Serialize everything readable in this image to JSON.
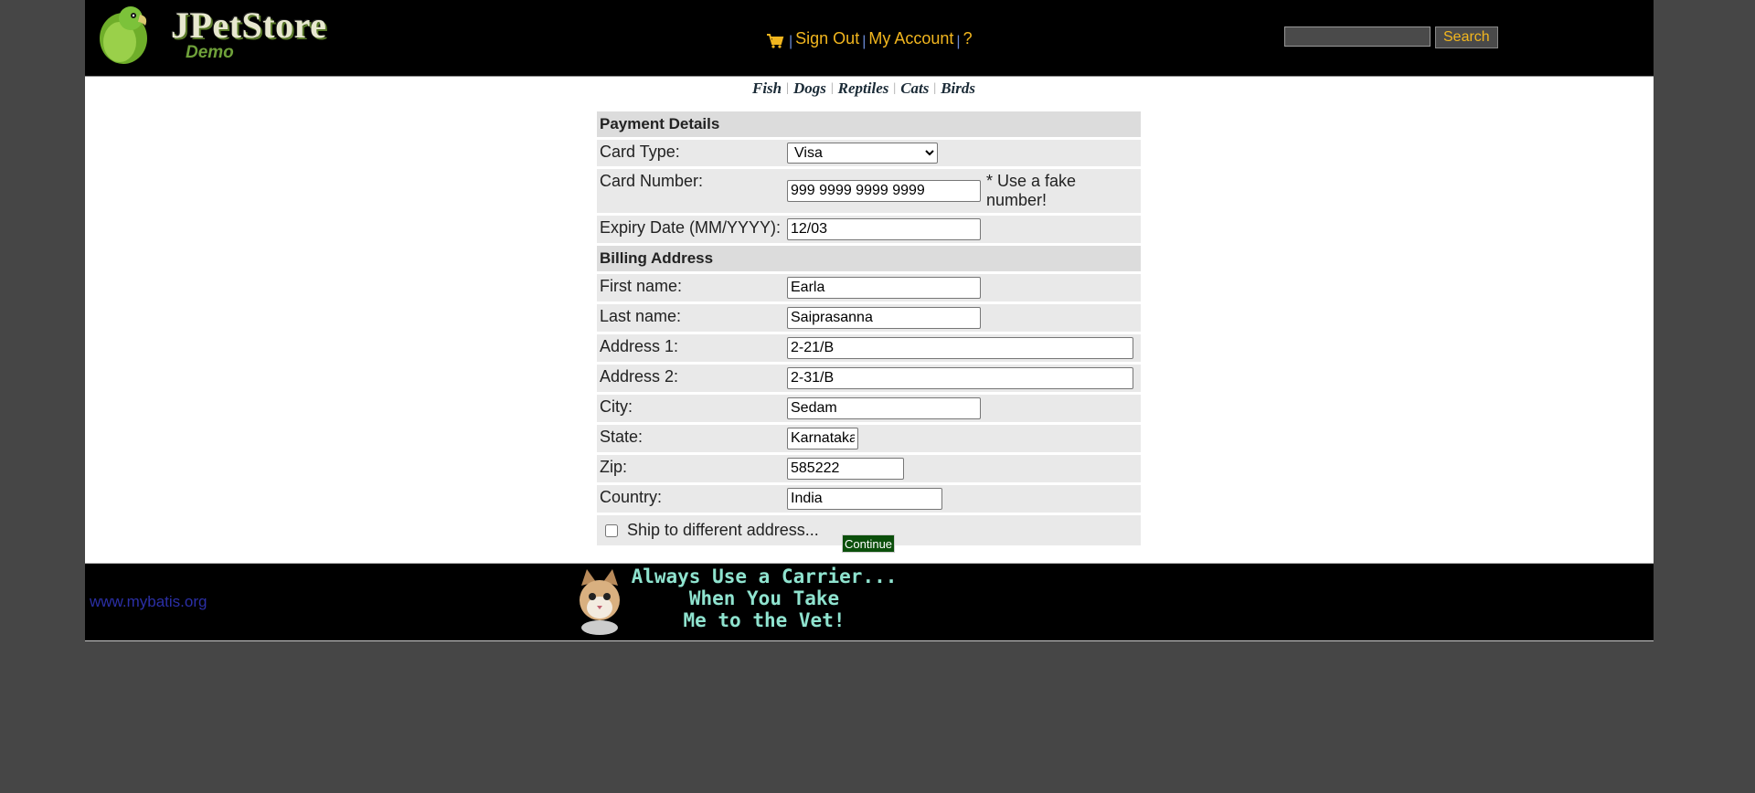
{
  "header": {
    "logo_title": "JPetStore",
    "logo_subtitle": "Demo",
    "menu": {
      "cart_icon": "cart-icon",
      "sign_out": "Sign Out",
      "my_account": "My Account",
      "help": "?",
      "separator": "|"
    },
    "search": {
      "input_value": "",
      "button_label": "Search"
    }
  },
  "quicklinks": [
    "Fish",
    "Dogs",
    "Reptiles",
    "Cats",
    "Birds"
  ],
  "payment": {
    "section_title": "Payment Details",
    "card_type_label": "Card Type:",
    "card_type_value": "Visa",
    "card_number_label": "Card Number:",
    "card_number_value": "999 9999 9999 9999",
    "card_number_note": "* Use a fake number!",
    "expiry_label": "Expiry Date (MM/YYYY):",
    "expiry_value": "12/03"
  },
  "billing": {
    "section_title": "Billing Address",
    "first_name_label": "First name:",
    "first_name_value": "Earla",
    "last_name_label": "Last name:",
    "last_name_value": "Saiprasanna",
    "address1_label": "Address 1:",
    "address1_value": "2-21/B",
    "address2_label": "Address 2:",
    "address2_value": "2-31/B",
    "city_label": "City:",
    "city_value": "Sedam",
    "state_label": "State:",
    "state_value": "Karnataka",
    "zip_label": "Zip:",
    "zip_value": "585222",
    "country_label": "Country:",
    "country_value": "India",
    "ship_different_label": "Ship to different address...",
    "ship_different_checked": false
  },
  "continue_label": "Continue",
  "footer": {
    "link_text": "www.mybatis.org",
    "banner_lines": [
      "Always Use a Carrier...",
      "When You Take",
      "Me to the Vet!"
    ]
  },
  "colors": {
    "page_bg": "#464646",
    "header_bg": "#000000",
    "menu_link": "#f2b61e",
    "continue_bg": "#0b4f0b",
    "footer_link": "#2b2fa6",
    "banner_text": "#8fe3cf"
  }
}
